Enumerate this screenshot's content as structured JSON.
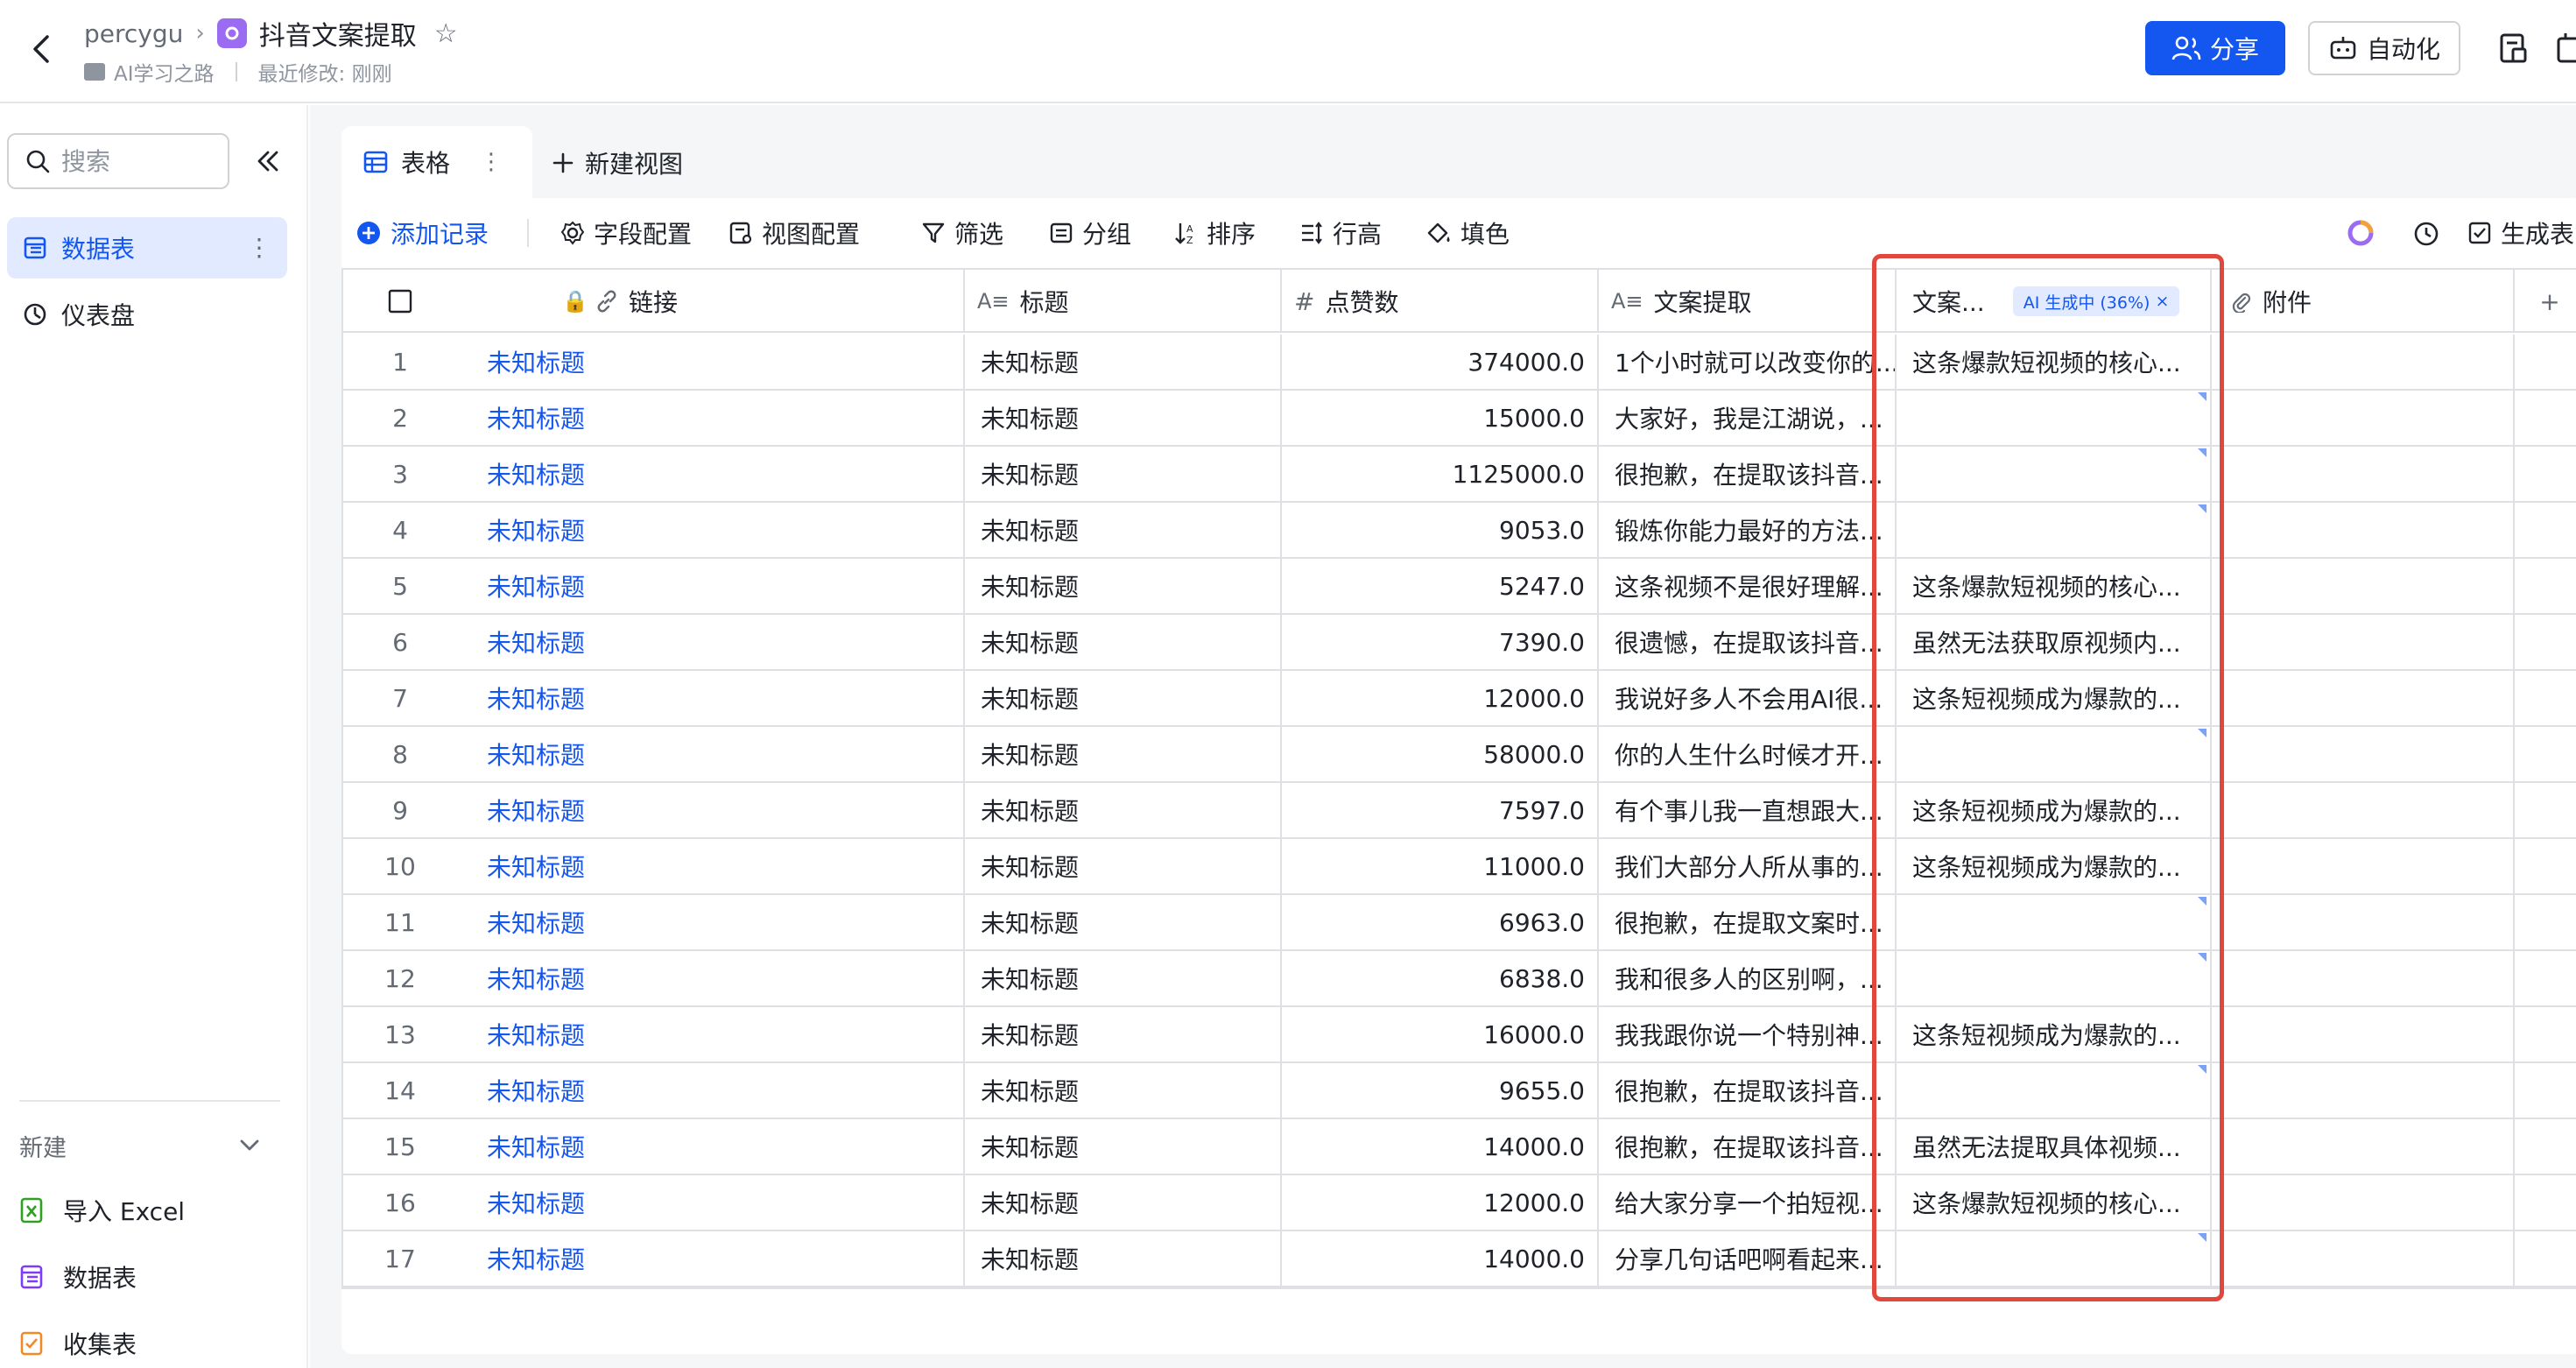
{
  "header": {
    "user": "percygu",
    "doc_title": "抖音文案提取",
    "folder": "AI学习之路",
    "last_modified": "最近修改: 刚刚",
    "share_label": "分享",
    "automation_label": "自动化"
  },
  "sidebar": {
    "search_placeholder": "搜索",
    "items": [
      {
        "label": "数据表"
      },
      {
        "label": "仪表盘"
      }
    ],
    "new_label": "新建",
    "new_items": [
      {
        "label": "导入 Excel"
      },
      {
        "label": "数据表"
      },
      {
        "label": "收集表"
      }
    ]
  },
  "tabs": {
    "active_label": "表格",
    "new_view_label": "新建视图"
  },
  "toolbar": {
    "add_record": "添加记录",
    "field_config": "字段配置",
    "view_config": "视图配置",
    "filter": "筛选",
    "group": "分组",
    "sort": "排序",
    "row_height": "行高",
    "fill_color": "填色",
    "generate_table": "生成表"
  },
  "table": {
    "columns": [
      "链接",
      "标题",
      "点赞数",
      "文案提取",
      "文案...",
      "附件"
    ],
    "ai_status": "AI 生成中 (36%)",
    "ai_progress_percent": 36,
    "rows": [
      {
        "idx": "1",
        "link": "未知标题",
        "title": "未知标题",
        "likes": "374000.0",
        "extract": "1个小时就可以改变你的...",
        "gen": "这条爆款短视频的核心..."
      },
      {
        "idx": "2",
        "link": "未知标题",
        "title": "未知标题",
        "likes": "15000.0",
        "extract": "大家好，我是江湖说，...",
        "gen": ""
      },
      {
        "idx": "3",
        "link": "未知标题",
        "title": "未知标题",
        "likes": "1125000.0",
        "extract": "很抱歉，在提取该抖音...",
        "gen": ""
      },
      {
        "idx": "4",
        "link": "未知标题",
        "title": "未知标题",
        "likes": "9053.0",
        "extract": "锻炼你能力最好的方法...",
        "gen": ""
      },
      {
        "idx": "5",
        "link": "未知标题",
        "title": "未知标题",
        "likes": "5247.0",
        "extract": "这条视频不是很好理解...",
        "gen": "这条爆款短视频的核心..."
      },
      {
        "idx": "6",
        "link": "未知标题",
        "title": "未知标题",
        "likes": "7390.0",
        "extract": "很遗憾，在提取该抖音...",
        "gen": "虽然无法获取原视频内..."
      },
      {
        "idx": "7",
        "link": "未知标题",
        "title": "未知标题",
        "likes": "12000.0",
        "extract": "我说好多人不会用AI很...",
        "gen": "这条短视频成为爆款的..."
      },
      {
        "idx": "8",
        "link": "未知标题",
        "title": "未知标题",
        "likes": "58000.0",
        "extract": "你的人生什么时候才开...",
        "gen": ""
      },
      {
        "idx": "9",
        "link": "未知标题",
        "title": "未知标题",
        "likes": "7597.0",
        "extract": "有个事儿我一直想跟大...",
        "gen": "这条短视频成为爆款的..."
      },
      {
        "idx": "10",
        "link": "未知标题",
        "title": "未知标题",
        "likes": "11000.0",
        "extract": "我们大部分人所从事的...",
        "gen": "这条短视频成为爆款的..."
      },
      {
        "idx": "11",
        "link": "未知标题",
        "title": "未知标题",
        "likes": "6963.0",
        "extract": "很抱歉，在提取文案时...",
        "gen": ""
      },
      {
        "idx": "12",
        "link": "未知标题",
        "title": "未知标题",
        "likes": "6838.0",
        "extract": "我和很多人的区别啊，...",
        "gen": ""
      },
      {
        "idx": "13",
        "link": "未知标题",
        "title": "未知标题",
        "likes": "16000.0",
        "extract": "我我跟你说一个特别神...",
        "gen": "这条短视频成为爆款的..."
      },
      {
        "idx": "14",
        "link": "未知标题",
        "title": "未知标题",
        "likes": "9655.0",
        "extract": "很抱歉，在提取该抖音...",
        "gen": ""
      },
      {
        "idx": "15",
        "link": "未知标题",
        "title": "未知标题",
        "likes": "14000.0",
        "extract": "很抱歉，在提取该抖音...",
        "gen": "虽然无法提取具体视频..."
      },
      {
        "idx": "16",
        "link": "未知标题",
        "title": "未知标题",
        "likes": "12000.0",
        "extract": "给大家分享一个拍短视...",
        "gen": "这条爆款短视频的核心..."
      },
      {
        "idx": "17",
        "link": "未知标题",
        "title": "未知标题",
        "likes": "14000.0",
        "extract": "分享几句话吧啊看起来...",
        "gen": ""
      }
    ]
  },
  "colors": {
    "primary": "#1456f0",
    "highlight_border": "#e0483e",
    "app_badge": "#9b6bf2"
  }
}
